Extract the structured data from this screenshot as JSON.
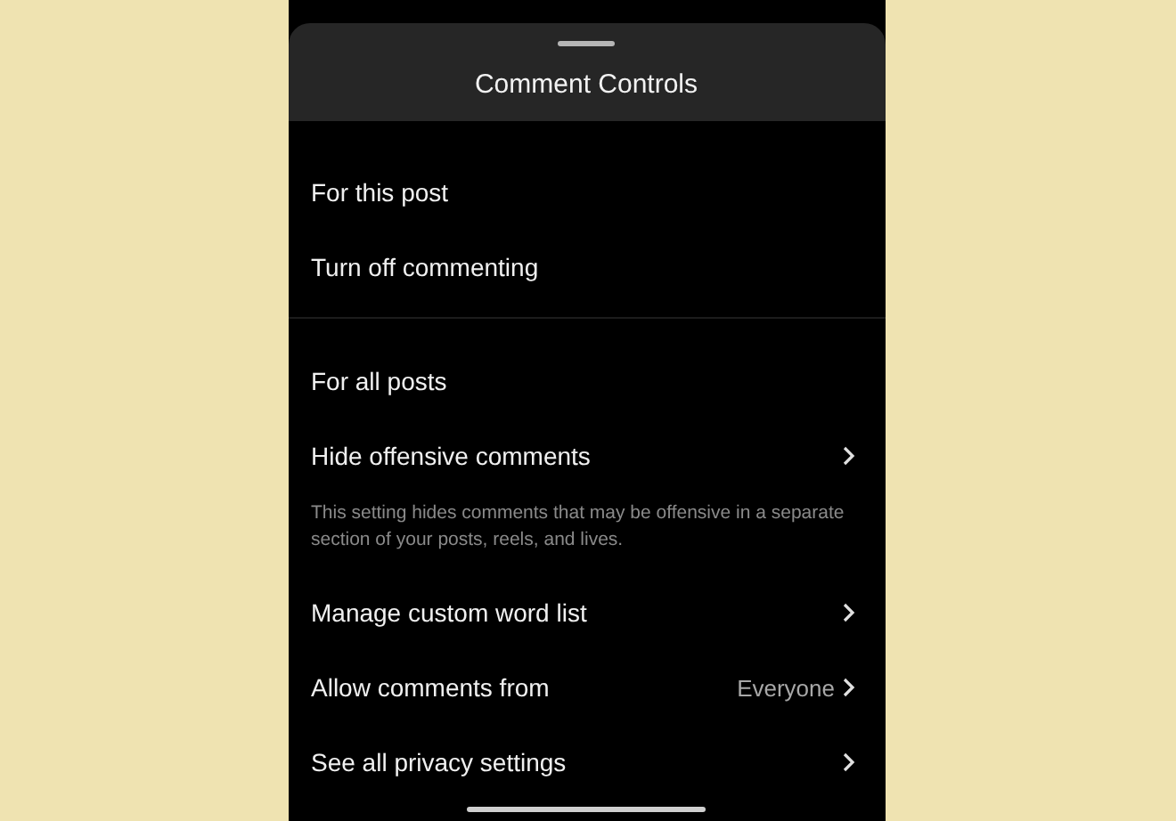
{
  "sheet": {
    "title": "Comment Controls"
  },
  "sections": [
    {
      "header": "For this post",
      "rows": [
        {
          "kind": "plain",
          "label": "Turn off commenting"
        }
      ]
    },
    {
      "header": "For all posts",
      "rows": [
        {
          "kind": "link",
          "label": "Hide offensive comments"
        },
        {
          "kind": "note",
          "label": "This setting hides comments that may be offensive in a separate section of your posts, reels, and lives."
        },
        {
          "kind": "link",
          "label": "Manage custom word list"
        },
        {
          "kind": "link",
          "label": "Allow comments from",
          "value": "Everyone"
        },
        {
          "kind": "link",
          "label": "See all privacy settings"
        }
      ]
    }
  ]
}
